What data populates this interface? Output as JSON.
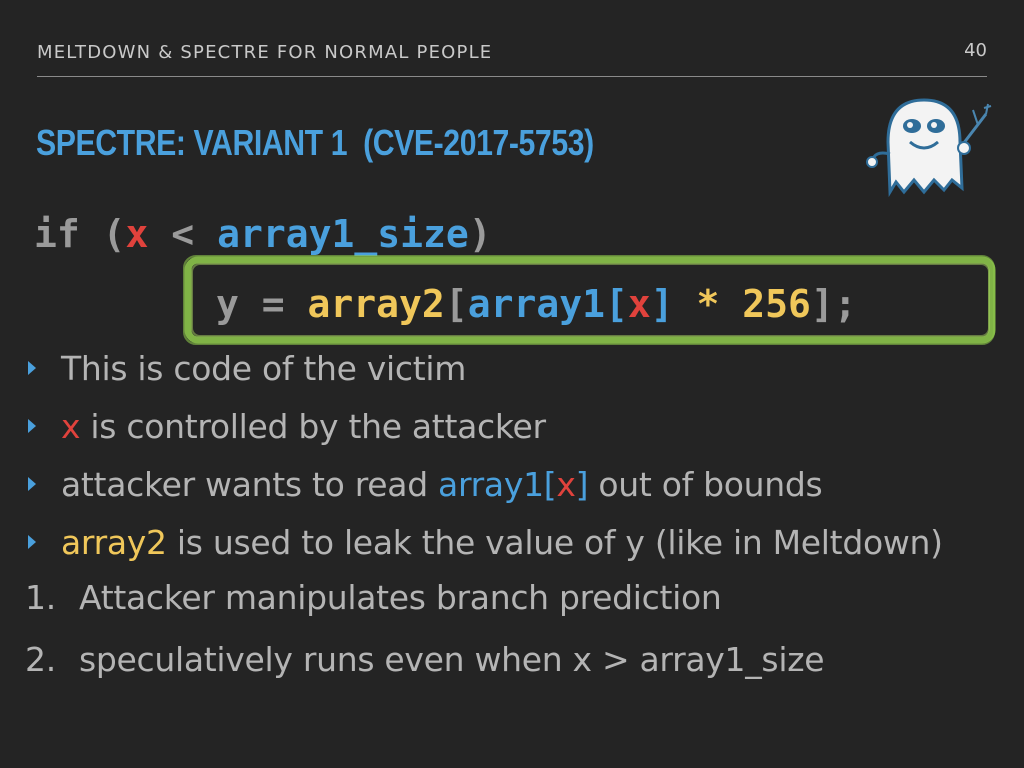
{
  "header": {
    "title": "MELTDOWN & SPECTRE FOR NORMAL PEOPLE",
    "page": "40"
  },
  "slide_title": "SPECTRE: VARIANT 1  (CVE-2017-5753)",
  "code": {
    "line1": {
      "kw": "if",
      "open": " (",
      "x": "x",
      "lt": " < ",
      "size": "array1_size",
      "close": ")"
    },
    "line2": {
      "y": "y",
      "eq": " = ",
      "arr2": "array2",
      "lb1": "[",
      "arr1": "array1",
      "lb2": "[",
      "x": "x",
      "rb2": "]",
      "mul": " * ",
      "num": "256",
      "end": "];"
    }
  },
  "bullets": [
    {
      "text": "This is code of the victim"
    },
    {
      "hl": "x",
      "rest": " is controlled by the attacker"
    },
    {
      "pre": "attacker wants to read ",
      "arr": "array1",
      "lb": "[",
      "x": "x",
      "rb": "]",
      "post": " out of bounds"
    },
    {
      "hl": "array2",
      "rest": " is used to leak the value of y (like in Meltdown)"
    }
  ],
  "numbered": [
    {
      "num": "1.",
      "text": "Attacker manipulates branch prediction"
    },
    {
      "num": "2.",
      "text": "speculatively runs even when x > array1_size"
    }
  ],
  "colors": {
    "accent": "#4aa0dd",
    "red": "#e0423c",
    "yellow": "#f0c75a",
    "highlight": "#8bc34a"
  },
  "icons": {
    "logo": "spectre-ghost-icon",
    "bullet": "triangle-bullet-icon"
  }
}
